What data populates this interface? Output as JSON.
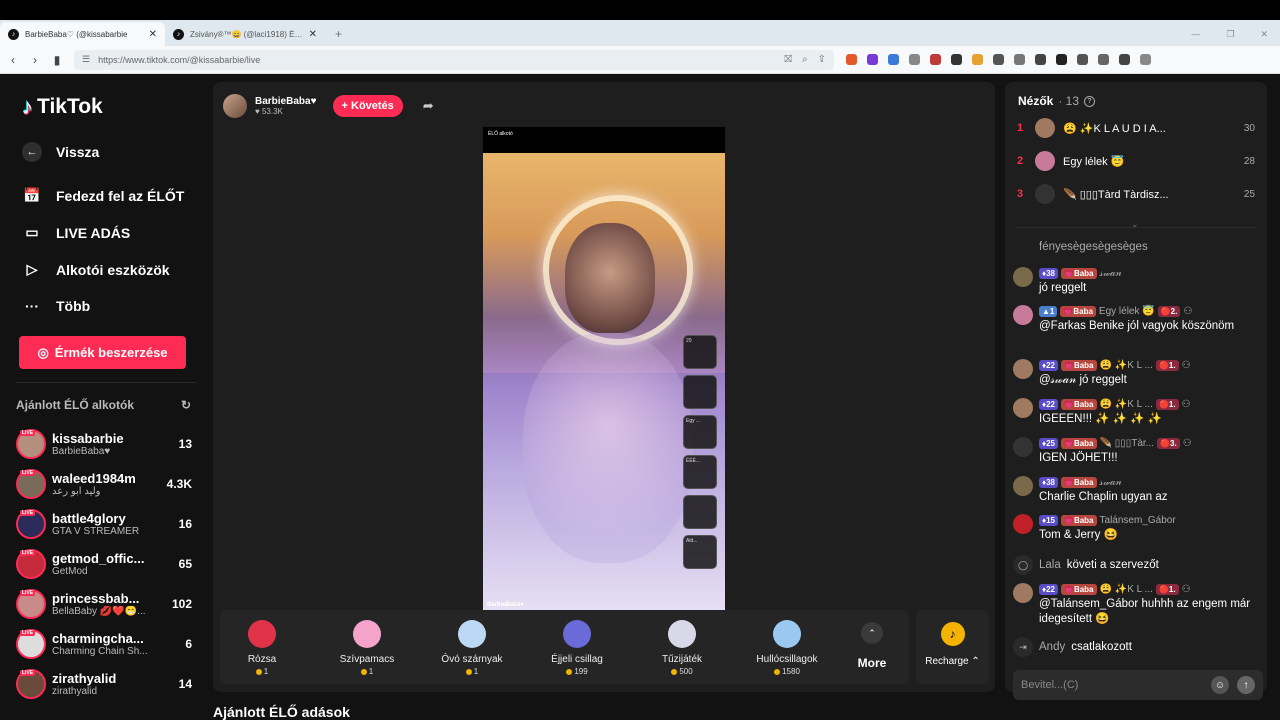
{
  "browser": {
    "tabs": [
      {
        "title": "BarbieBaba♡ (@kissabarbie",
        "favicon": "tiktok-icon"
      },
      {
        "title": "Zsivány®™😄 (@laci1918) ÉLŐ adás",
        "favicon": "tiktok-icon"
      }
    ],
    "url": "https://www.tiktok.com/@kissabarbie/live"
  },
  "sidebar": {
    "logo_text": "TikTok",
    "nav": [
      {
        "label": "Vissza",
        "icon": "back-arrow-icon"
      },
      {
        "label": "Fedezd fel az ÉLŐT",
        "icon": "live-tv-icon"
      },
      {
        "label": "LIVE ADÁS",
        "icon": "video-camera-icon"
      },
      {
        "label": "Alkotói eszközök",
        "icon": "creator-tools-icon"
      },
      {
        "label": "Több",
        "icon": "more-dots-icon"
      }
    ],
    "coins_button": "Érmék beszerzése",
    "recommended_title": "Ajánlott ÉLŐ alkotók",
    "live_badge": "LIVE",
    "creators": [
      {
        "name": "kissabarbie",
        "sub": "BarbieBaba♥",
        "count": "13",
        "color": "#b58f7d"
      },
      {
        "name": "waleed1984m",
        "sub": "وليد ابو رعد",
        "count": "4.3K",
        "color": "#7a6a5a"
      },
      {
        "name": "battle4glory",
        "sub": "GTA V STREAMER",
        "count": "16",
        "color": "#2b2b5a"
      },
      {
        "name": "getmod_offic...",
        "sub": "GetMod",
        "count": "65",
        "color": "#c42a3a"
      },
      {
        "name": "princessbab...",
        "sub": "BellaBaby 💋❤️😁...",
        "count": "102",
        "color": "#c98a8a"
      },
      {
        "name": "charmingcha...",
        "sub": "Charming Chain Sh...",
        "count": "6",
        "color": "#ddd"
      },
      {
        "name": "zirathyalid",
        "sub": "zirathyalid",
        "count": "14",
        "color": "#6a4a3a"
      }
    ]
  },
  "stream": {
    "host_name": "BarbieBaba♥",
    "host_likes": "♥ 53.3K",
    "follow_label": "+ Követés",
    "video_top_label": "ÉLŐ alkotó",
    "watermark": "BarbieBaba♥",
    "side_gifts": [
      "20",
      "Egy ...",
      "ÉÉÉ...",
      "Ald..."
    ]
  },
  "gifts": [
    {
      "name": "Rózsa",
      "price": "1",
      "color": "#e0334a"
    },
    {
      "name": "Szívpamacs",
      "price": "1",
      "color": "#f5a3c8"
    },
    {
      "name": "Óvó szárnyak",
      "price": "1",
      "color": "#bcd8f5"
    },
    {
      "name": "Éjjeli csillag",
      "price": "199",
      "color": "#6a6ad8"
    },
    {
      "name": "Tűzijáték",
      "price": "500",
      "color": "#d8d8e8"
    },
    {
      "name": "Hullócsillagok",
      "price": "1580",
      "color": "#9ac8f0"
    }
  ],
  "more_label": "More",
  "recharge_label": "Recharge ⌃",
  "recommended_live": "Ajánlott ÉLŐ adások",
  "viewers": {
    "title": "Nézők",
    "count": "· 13",
    "list": [
      {
        "rank": "1",
        "name": "😩 ✨K L A U D I A...",
        "score": "30",
        "color": "#a07a60"
      },
      {
        "rank": "2",
        "name": "Egy lélek 😇",
        "score": "28",
        "color": "#c87a9a"
      },
      {
        "rank": "3",
        "name": "🪶 ▯▯▯Tàrd Tàrdisz...",
        "score": "25",
        "color": "#333"
      }
    ]
  },
  "chat": [
    {
      "faded": "fényesègesègesèges",
      "badges": [],
      "name": "",
      "text": ""
    },
    {
      "badges": [
        "♦38",
        "💗Baba"
      ],
      "name": "𝓈𝓌𝒶𝓃",
      "text": "jó reggelt",
      "color": "#7a6a4a"
    },
    {
      "badges": [
        "▲1",
        "💗Baba"
      ],
      "name": "Egy lélek 😇",
      "extra": "🔴2.",
      "text": "@Farkas Benike jól vagyok köszönöm",
      "color": "#c87a9a"
    },
    {
      "badges": [
        "♦22",
        "💗Baba"
      ],
      "name": "😩 ✨K L ...",
      "extra": "🔴1.",
      "text": "@𝓈𝓌𝒶𝓃 jó reggelt",
      "color": "#a07a60"
    },
    {
      "badges": [
        "♦22",
        "💗Baba"
      ],
      "name": "😩 ✨K L ...",
      "extra": "🔴1.",
      "text": "IGEEEN!!! ✨ ✨ ✨ ✨",
      "color": "#a07a60"
    },
    {
      "badges": [
        "♦25",
        "💗Baba"
      ],
      "name": "🪶 ▯▯▯Tàr...",
      "extra": "🔴3.",
      "text": "IGEN JÖHET!!!",
      "color": "#333"
    },
    {
      "badges": [
        "♦38",
        "💗Baba"
      ],
      "name": "𝓈𝓌𝒶𝓃",
      "text": "Charlie Chaplin ugyan az",
      "color": "#7a6a4a"
    },
    {
      "badges": [
        "♦15",
        "💗Baba"
      ],
      "name": "Talánsem_Gábor",
      "text": "Tom & Jerry 😆",
      "color": "#c0202a"
    },
    {
      "system": true,
      "name": "Lala",
      "text": "követi a szervezőt"
    },
    {
      "badges": [
        "♦22",
        "💗Baba"
      ],
      "name": "😩 ✨K L ...",
      "extra": "🔴1.",
      "text": "@Talánsem_Gábor huhhh az engem már idegesített 😆",
      "color": "#a07a60"
    },
    {
      "system": true,
      "name": "Andy",
      "text": "csatlakozott"
    }
  ],
  "input_placeholder": "Bevitel...(C)"
}
